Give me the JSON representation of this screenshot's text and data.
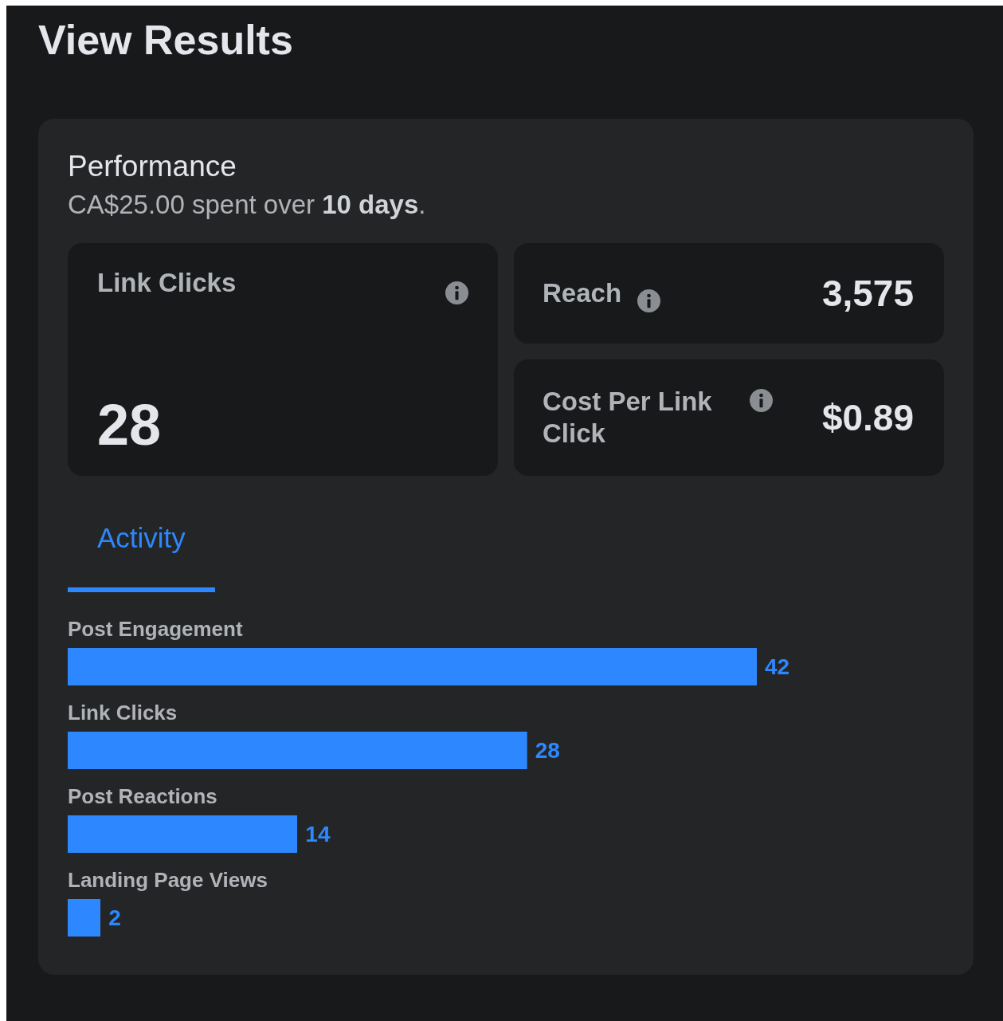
{
  "page": {
    "title": "View Results"
  },
  "performance": {
    "title": "Performance",
    "summary": "CA$25.00 spent over **10 days**."
  },
  "metrics": [
    {
      "label": "Link Clicks",
      "value": "28",
      "kind": "large"
    },
    {
      "label": "Reach",
      "value": "3,575",
      "kind": "row"
    },
    {
      "label": "Cost Per Link Click",
      "value": "$0.89",
      "kind": "row"
    }
  ],
  "tabs": [
    {
      "label": "Activity",
      "selected": true
    }
  ],
  "activity": {
    "chart_data": {
      "type": "bar",
      "orientation": "horizontal",
      "categories": [
        "Post Engagement",
        "Link Clicks",
        "Post Reactions",
        "Landing Page Views"
      ],
      "series": [
        {
          "color": "#2d88ff",
          "values": [
            42,
            28,
            14,
            2
          ]
        }
      ],
      "data_labels": true
    }
  }
}
